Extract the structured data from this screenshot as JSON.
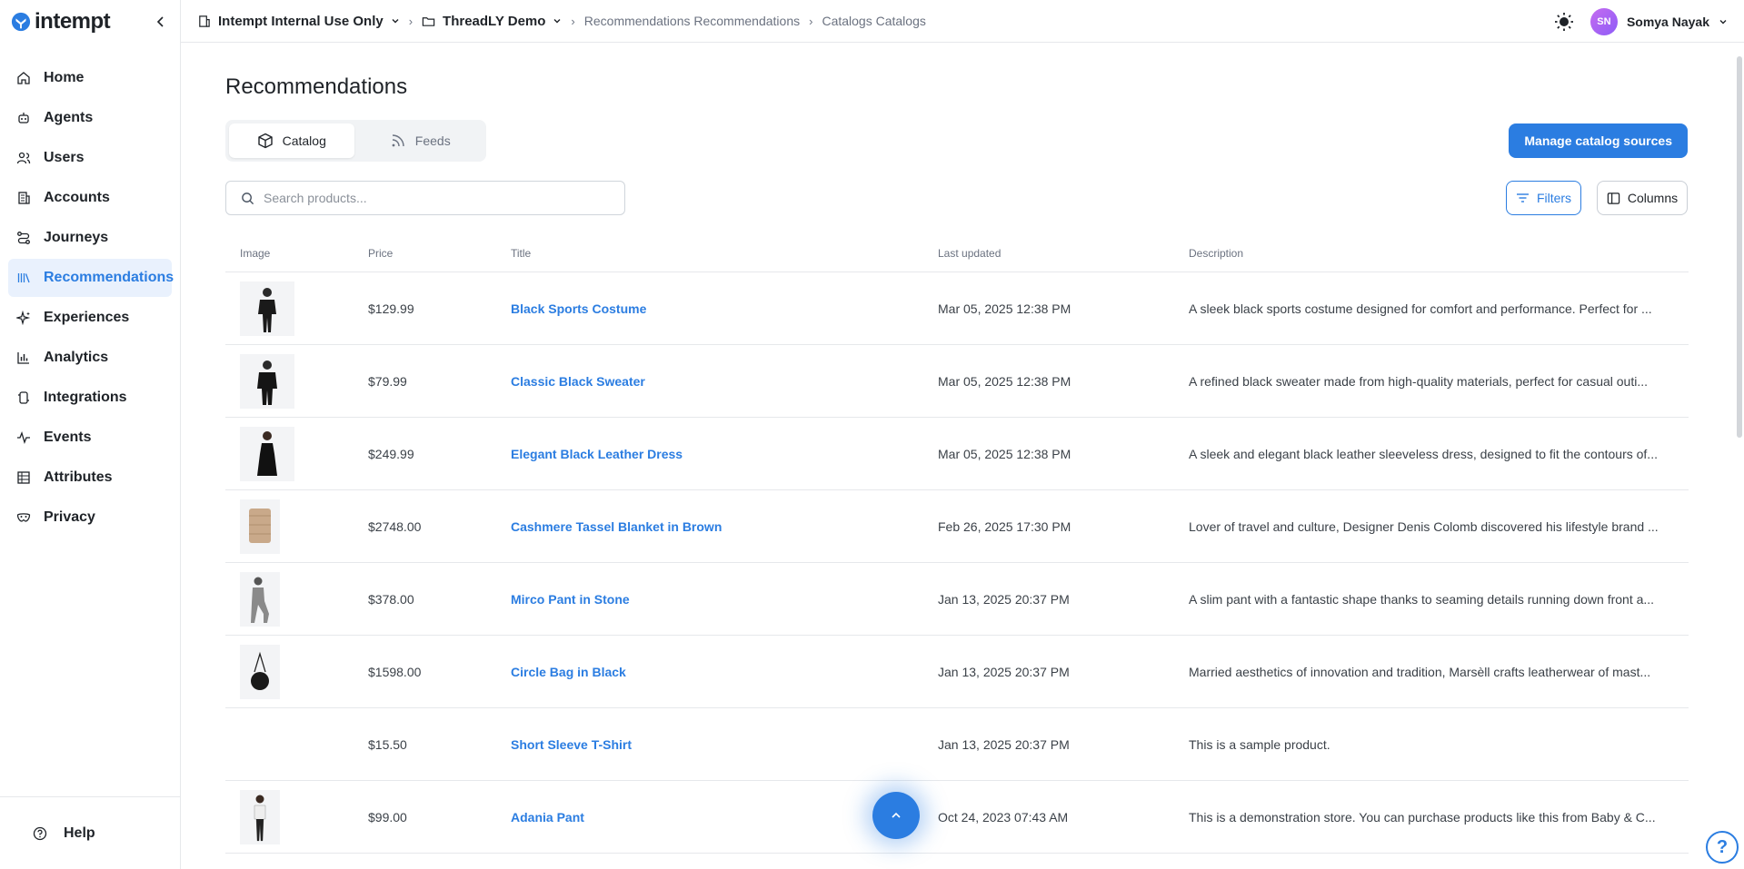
{
  "brand": {
    "name": "intempt",
    "accent": "#2b7de1"
  },
  "sidebar": {
    "items": [
      {
        "label": "Home",
        "icon": "home-icon"
      },
      {
        "label": "Agents",
        "icon": "robot-icon"
      },
      {
        "label": "Users",
        "icon": "users-icon"
      },
      {
        "label": "Accounts",
        "icon": "building-icon"
      },
      {
        "label": "Journeys",
        "icon": "route-icon"
      },
      {
        "label": "Recommendations",
        "icon": "library-icon",
        "active": true
      },
      {
        "label": "Experiences",
        "icon": "sparkle-icon"
      },
      {
        "label": "Analytics",
        "icon": "bar-chart-icon"
      },
      {
        "label": "Integrations",
        "icon": "plug-icon"
      },
      {
        "label": "Events",
        "icon": "activity-icon"
      },
      {
        "label": "Attributes",
        "icon": "table-icon"
      },
      {
        "label": "Privacy",
        "icon": "mask-icon"
      }
    ],
    "help": "Help"
  },
  "topbar": {
    "org": "Intempt Internal Use Only",
    "project": "ThreadLY Demo",
    "crumb1": "Recommendations Recommendations",
    "crumb2": "Catalogs Catalogs",
    "user_initials": "SN",
    "user_name": "Somya Nayak"
  },
  "main": {
    "title": "Recommendations",
    "tabs": [
      {
        "label": "Catalog",
        "icon": "cube-icon",
        "active": true
      },
      {
        "label": "Feeds",
        "icon": "rss-icon"
      }
    ],
    "manage_button": "Manage catalog sources",
    "search_placeholder": "Search products...",
    "filters_label": "Filters",
    "columns_label": "Columns"
  },
  "table": {
    "headers": [
      "Image",
      "Price",
      "Title",
      "Last updated",
      "Description"
    ],
    "rows": [
      {
        "price": "$129.99",
        "title": "Black Sports Costume",
        "updated": "Mar 05, 2025 12:38 PM",
        "description": "A sleek black sports costume designed for comfort and performance. Perfect for ...",
        "image": "person-dark"
      },
      {
        "price": "$79.99",
        "title": "Classic Black Sweater",
        "updated": "Mar 05, 2025 12:38 PM",
        "description": "A refined black sweater made from high-quality materials, perfect for casual outi...",
        "image": "person-dark"
      },
      {
        "price": "$249.99",
        "title": "Elegant Black Leather Dress",
        "updated": "Mar 05, 2025 12:38 PM",
        "description": "A sleek and elegant black leather sleeveless dress, designed to fit the contours of...",
        "image": "dress"
      },
      {
        "price": "$2748.00",
        "title": "Cashmere Tassel Blanket in Brown",
        "updated": "Feb 26, 2025 17:30 PM",
        "description": "Lover of travel and culture, Designer Denis Colomb discovered his lifestyle brand ...",
        "image": "blanket"
      },
      {
        "price": "$378.00",
        "title": "Mirco Pant in Stone",
        "updated": "Jan 13, 2025 20:37 PM",
        "description": "A slim pant with a fantastic shape thanks to seaming details running down front a...",
        "image": "person-grey"
      },
      {
        "price": "$1598.00",
        "title": "Circle Bag in Black",
        "updated": "Jan 13, 2025 20:37 PM",
        "description": "Married aesthetics of innovation and tradition, Marsèll crafts leatherwear of mast...",
        "image": "bag"
      },
      {
        "price": "$15.50",
        "title": "Short Sleeve T-Shirt",
        "updated": "Jan 13, 2025 20:37 PM",
        "description": "This is a sample product.",
        "image": "none"
      },
      {
        "price": "$99.00",
        "title": "Adania Pant",
        "updated": "Oct 24, 2023 07:43 AM",
        "description": "This is a demonstration store. You can purchase products like this from Baby & C...",
        "image": "person-light"
      }
    ]
  },
  "help_fab": "?"
}
